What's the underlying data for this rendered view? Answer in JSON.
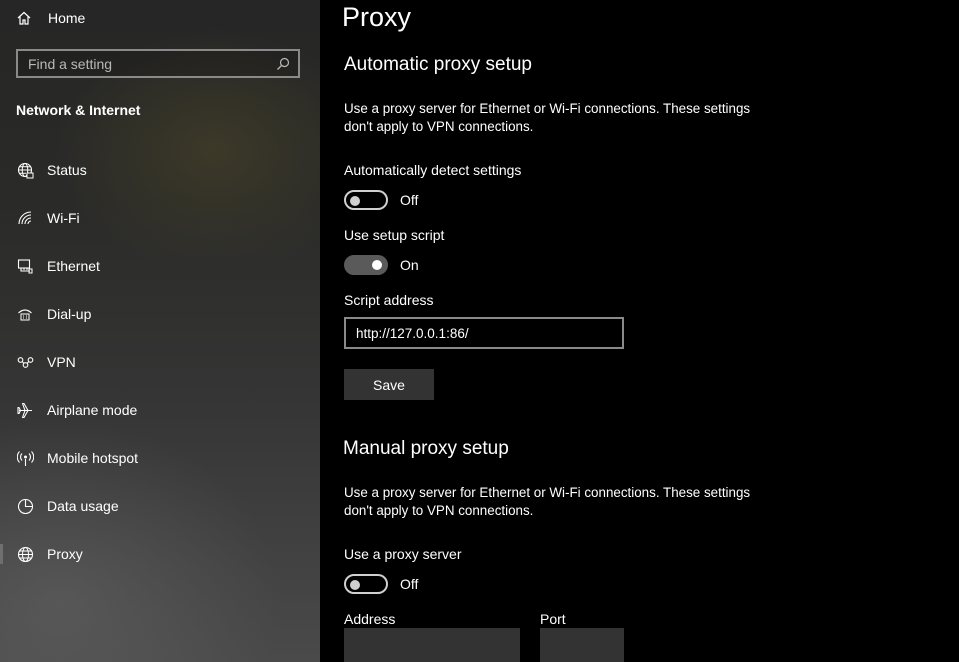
{
  "sidebar": {
    "home_label": "Home",
    "search_placeholder": "Find a setting",
    "section_title": "Network & Internet",
    "items": [
      {
        "label": "Status",
        "icon": "globe-status-icon"
      },
      {
        "label": "Wi-Fi",
        "icon": "wifi-icon"
      },
      {
        "label": "Ethernet",
        "icon": "ethernet-icon"
      },
      {
        "label": "Dial-up",
        "icon": "dialup-icon"
      },
      {
        "label": "VPN",
        "icon": "vpn-icon"
      },
      {
        "label": "Airplane mode",
        "icon": "airplane-icon"
      },
      {
        "label": "Mobile hotspot",
        "icon": "hotspot-icon"
      },
      {
        "label": "Data usage",
        "icon": "pie-chart-icon"
      },
      {
        "label": "Proxy",
        "icon": "globe-icon",
        "selected": true
      }
    ]
  },
  "main": {
    "title": "Proxy",
    "automatic": {
      "heading": "Automatic proxy setup",
      "description": "Use a proxy server for Ethernet or Wi-Fi connections. These settings don't apply to VPN connections.",
      "detect_label": "Automatically detect settings",
      "detect_state": "Off",
      "script_label": "Use setup script",
      "script_state": "On",
      "address_label": "Script address",
      "address_value": "http://127.0.0.1:86/",
      "save_label": "Save"
    },
    "manual": {
      "heading": "Manual proxy setup",
      "description": "Use a proxy server for Ethernet or Wi-Fi connections. These settings don't apply to VPN connections.",
      "proxy_label": "Use a proxy server",
      "proxy_state": "Off",
      "address_label": "Address",
      "port_label": "Port",
      "address_value": "",
      "port_value": ""
    }
  },
  "colors": {
    "background": "#000000",
    "toggle_on": "#5a5a5a",
    "button": "#333333",
    "input_border": "#8a8a8a"
  }
}
